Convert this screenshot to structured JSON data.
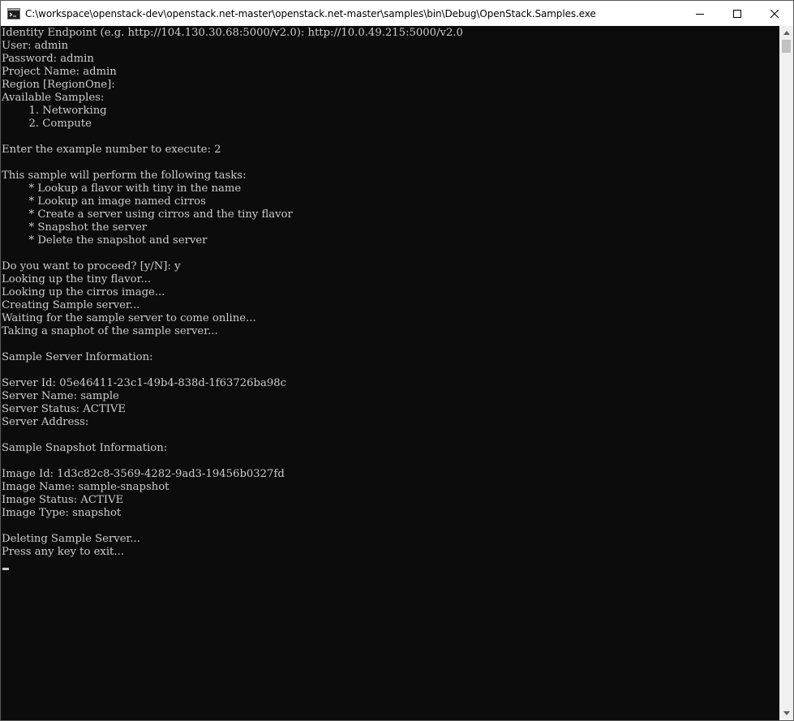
{
  "window": {
    "title": "C:\\workspace\\openstack-dev\\openstack.net-master\\openstack.net-master\\samples\\bin\\Debug\\OpenStack.Samples.exe"
  },
  "console": {
    "lines": [
      "Identity Endpoint (e.g. http://104.130.30.68:5000/v2.0): http://10.0.49.215:5000/v2.0",
      "User: admin",
      "Password: admin",
      "Project Name: admin",
      "Region [RegionOne]:",
      "Available Samples:",
      "        1. Networking",
      "        2. Compute",
      "",
      "Enter the example number to execute: 2",
      "",
      "This sample will perform the following tasks:",
      "        * Lookup a flavor with tiny in the name",
      "        * Lookup an image named cirros",
      "        * Create a server using cirros and the tiny flavor",
      "        * Snapshot the server",
      "        * Delete the snapshot and server",
      "",
      "Do you want to proceed? [y/N]: y",
      "Looking up the tiny flavor...",
      "Looking up the cirros image...",
      "Creating Sample server...",
      "Waiting for the sample server to come online...",
      "Taking a snaphot of the sample server...",
      "",
      "Sample Server Information:",
      "",
      "Server Id: 05e46411-23c1-49b4-838d-1f63726ba98c",
      "Server Name: sample",
      "Server Status: ACTIVE",
      "Server Address:",
      "",
      "Sample Snapshot Information:",
      "",
      "Image Id: 1d3c82c8-3569-4282-9ad3-19456b0327fd",
      "Image Name: sample-snapshot",
      "Image Status: ACTIVE",
      "Image Type: snapshot",
      "",
      "Deleting Sample Server...",
      "Press any key to exit..."
    ]
  },
  "colors": {
    "console_background": "#0c0c0c",
    "console_text": "#cccccc",
    "titlebar_background": "#ffffff"
  },
  "icons": {
    "app": "console-app-icon",
    "minimize": "minimize-icon",
    "maximize": "maximize-icon",
    "close": "close-icon",
    "scroll_up": "scroll-up-arrow-icon",
    "scroll_down": "scroll-down-arrow-icon"
  }
}
